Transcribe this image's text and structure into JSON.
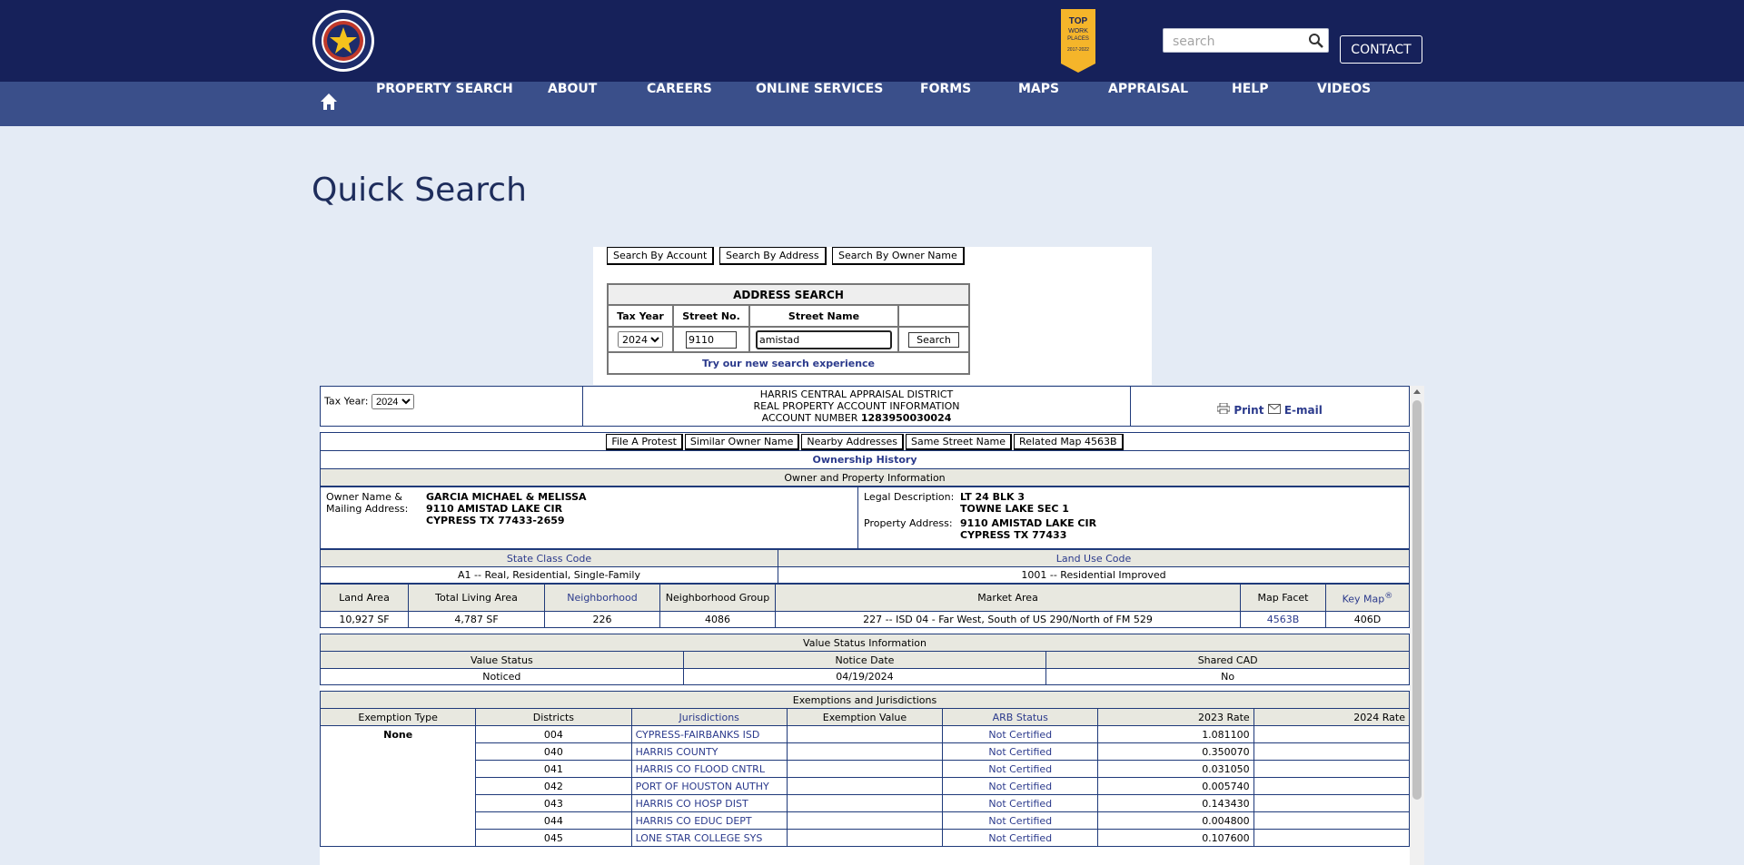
{
  "header": {
    "logo_alt": "Harris Central Appraisal District Texas",
    "search_placeholder": "search",
    "contact_label": "CONTACT",
    "badge": {
      "line1": "TOP",
      "line2": "WORK",
      "line3": "PLACES",
      "years": "2017-2022"
    }
  },
  "nav": {
    "items": [
      "PROPERTY SEARCH",
      "ABOUT",
      "CAREERS",
      "ONLINE SERVICES",
      "FORMS",
      "MAPS",
      "APPRAISAL",
      "HELP",
      "VIDEOS"
    ]
  },
  "page_title": "Quick Search",
  "search_panel": {
    "tabs": [
      "Search By Account",
      "Search By Address",
      "Search By Owner Name"
    ],
    "title": "ADDRESS SEARCH",
    "col_tax_year": "Tax Year",
    "col_street_no": "Street No.",
    "col_street_name": "Street Name",
    "tax_year": "2024",
    "street_no": "9110",
    "street_name": "amistad",
    "search_label": "Search",
    "try_link": "Try our new search experience"
  },
  "result": {
    "tax_year_label": "Tax Year:",
    "tax_year": "2024",
    "district": "HARRIS CENTRAL APPRAISAL DISTRICT",
    "subtitle": "REAL PROPERTY ACCOUNT INFORMATION",
    "account_label": "ACCOUNT NUMBER",
    "account_number": "1283950030024",
    "print_label": "Print",
    "email_label": "E-mail",
    "actions": [
      "File A Protest",
      "Similar Owner Name",
      "Nearby Addresses",
      "Same Street Name",
      "Related Map 4563B"
    ],
    "ownership_history": "Ownership History",
    "owner_section": "Owner and Property Information",
    "owner_label1": "Owner Name &",
    "owner_label2": "Mailing Address:",
    "owner_name": "GARCIA MICHAEL & MELISSA",
    "owner_addr1": "9110 AMISTAD LAKE CIR",
    "owner_addr2": "CYPRESS TX 77433-2659",
    "legal_label": "Legal Description:",
    "legal1": "LT 24 BLK 3",
    "legal2": "TOWNE LAKE SEC 1",
    "prop_addr_label": "Property Address:",
    "prop_addr1": "9110 AMISTAD LAKE CIR",
    "prop_addr2": "CYPRESS TX 77433",
    "state_class_label": "State Class Code",
    "state_class": "A1 -- Real, Residential, Single-Family",
    "land_use_label": "Land Use Code",
    "land_use": "1001 -- Residential Improved",
    "details_headers": {
      "land_area": "Land Area",
      "living_area": "Total Living Area",
      "neighborhood": "Neighborhood",
      "nbhd_group": "Neighborhood Group",
      "market_area": "Market Area",
      "map_facet": "Map Facet",
      "key_map": "Key Map",
      "key_map_mark": "®"
    },
    "details": {
      "land_area": "10,927 SF",
      "living_area": "4,787 SF",
      "neighborhood": "226",
      "nbhd_group": "4086",
      "market_area": "227 -- ISD 04 - Far West, South of US 290/North of FM 529",
      "map_facet": "4563B",
      "key_map": "406D"
    },
    "value_status_section": "Value Status Information",
    "value_status_headers": {
      "status": "Value Status",
      "notice_date": "Notice Date",
      "shared_cad": "Shared CAD"
    },
    "value_status": {
      "status": "Noticed",
      "notice_date": "04/19/2024",
      "shared_cad": "No"
    },
    "exemptions_section": "Exemptions and Jurisdictions",
    "exemption_headers": {
      "type": "Exemption Type",
      "districts": "Districts",
      "jurisdictions": "Jurisdictions",
      "value": "Exemption Value",
      "arb": "ARB Status",
      "rate_2023": "2023 Rate",
      "rate_2024": "2024 Rate"
    },
    "exemption_type": "None",
    "jurisdictions": [
      {
        "district": "004",
        "name": "CYPRESS-FAIRBANKS ISD",
        "arb": "Not Certified",
        "rate": "1.081100"
      },
      {
        "district": "040",
        "name": "HARRIS COUNTY",
        "arb": "Not Certified",
        "rate": "0.350070"
      },
      {
        "district": "041",
        "name": "HARRIS CO FLOOD CNTRL",
        "arb": "Not Certified",
        "rate": "0.031050"
      },
      {
        "district": "042",
        "name": "PORT OF HOUSTON AUTHY",
        "arb": "Not Certified",
        "rate": "0.005740"
      },
      {
        "district": "043",
        "name": "HARRIS CO HOSP DIST",
        "arb": "Not Certified",
        "rate": "0.143430"
      },
      {
        "district": "044",
        "name": "HARRIS CO EDUC DEPT",
        "arb": "Not Certified",
        "rate": "0.004800"
      },
      {
        "district": "045",
        "name": "LONE STAR COLLEGE SYS",
        "arb": "Not Certified",
        "rate": "0.107600"
      }
    ]
  }
}
